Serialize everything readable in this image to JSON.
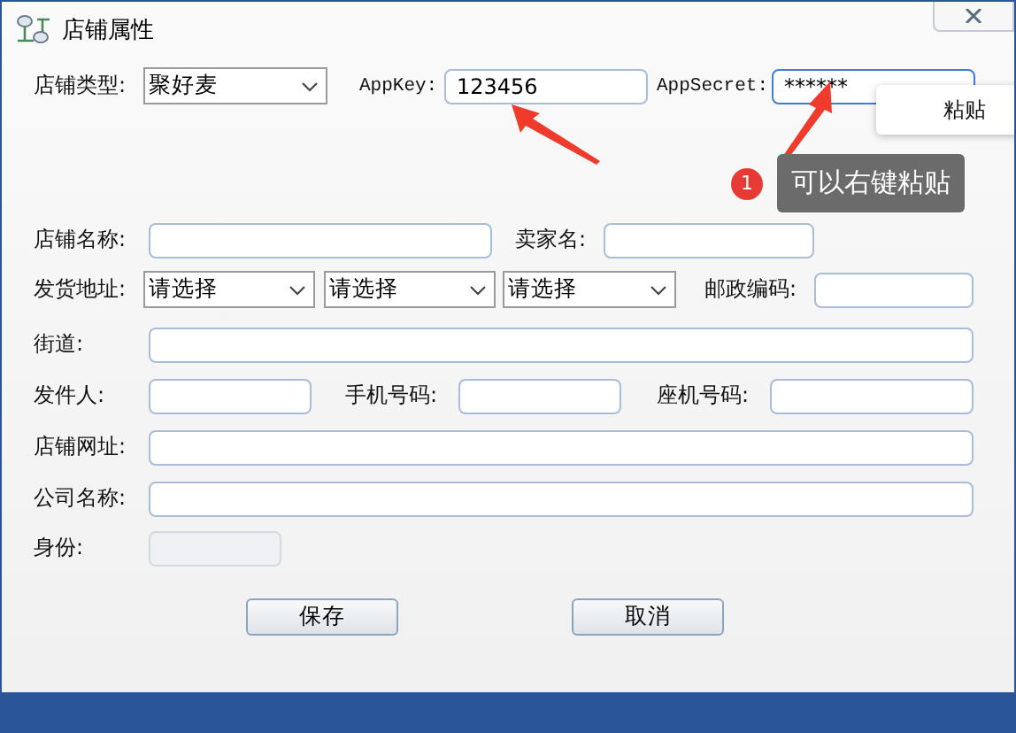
{
  "window": {
    "title": "店铺属性"
  },
  "form_rows": [
    {
      "items": [
        {
          "kind": "label",
          "text": "店铺类型:"
        },
        {
          "kind": "select",
          "value": "聚好麦"
        },
        {
          "kind": "code_label",
          "text": "AppKey:"
        },
        {
          "kind": "input",
          "value": "123456",
          "focused": false,
          "disabled": false
        },
        {
          "kind": "code_label",
          "text": "AppSecret:"
        },
        {
          "kind": "input",
          "value": "******",
          "focused": true,
          "disabled": false
        }
      ]
    },
    {
      "items": [
        {
          "kind": "label",
          "text": "店铺名称:"
        },
        {
          "kind": "input",
          "focused": false,
          "disabled": false
        },
        {
          "kind": "label",
          "text": "卖家名:"
        },
        {
          "kind": "input",
          "focused": false,
          "disabled": false
        }
      ]
    },
    {
      "items": [
        {
          "kind": "label",
          "text": "发货地址:"
        },
        {
          "kind": "select",
          "value": "请选择"
        },
        {
          "kind": "select",
          "value": "请选择"
        },
        {
          "kind": "select",
          "value": "请选择"
        },
        {
          "kind": "label",
          "text": "邮政编码:"
        },
        {
          "kind": "input",
          "focused": false,
          "disabled": false
        }
      ]
    },
    {
      "items": [
        {
          "kind": "label",
          "text": "街道:"
        },
        {
          "kind": "input",
          "focused": false,
          "disabled": false
        }
      ]
    },
    {
      "items": [
        {
          "kind": "label",
          "text": "发件人:"
        },
        {
          "kind": "input",
          "focused": false,
          "disabled": false
        },
        {
          "kind": "label",
          "text": "手机号码:"
        },
        {
          "kind": "input",
          "focused": false,
          "disabled": false
        },
        {
          "kind": "label",
          "text": "座机号码:"
        },
        {
          "kind": "input",
          "focused": false,
          "disabled": false
        }
      ]
    },
    {
      "items": [
        {
          "kind": "label",
          "text": "店铺网址:"
        },
        {
          "kind": "input",
          "focused": false,
          "disabled": false
        }
      ]
    },
    {
      "items": [
        {
          "kind": "label",
          "text": "公司名称:"
        },
        {
          "kind": "input",
          "focused": false,
          "disabled": false
        }
      ]
    },
    {
      "items": [
        {
          "kind": "label",
          "text": "身份:"
        },
        {
          "kind": "input",
          "focused": false,
          "disabled": true
        }
      ]
    }
  ],
  "buttons": [
    {
      "label": "保存"
    },
    {
      "label": "取消"
    }
  ],
  "context_menu": {
    "items": [
      "粘贴"
    ]
  },
  "callout": {
    "badge": "1",
    "text": "可以右键粘贴"
  }
}
